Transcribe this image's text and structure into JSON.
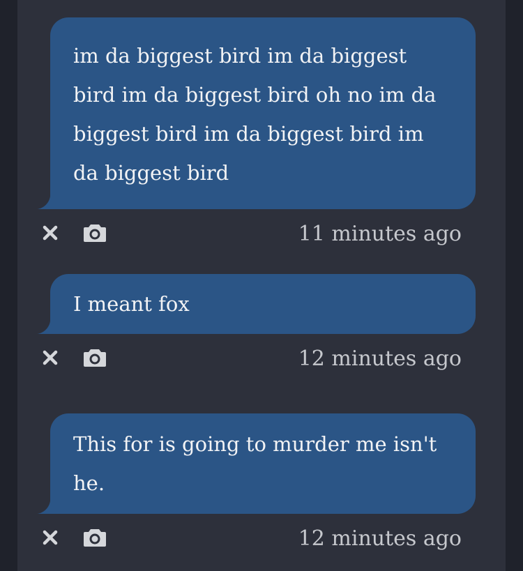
{
  "messages": [
    {
      "text": "im da biggest bird im da biggest bird im da biggest bird oh no im da biggest bird im da biggest bird im da biggest bird",
      "timestamp": "11 minutes ago",
      "actions": {
        "delete_icon": "close-icon",
        "screenshot_icon": "camera-icon"
      }
    },
    {
      "text": "I meant fox",
      "timestamp": "12 minutes ago",
      "actions": {
        "delete_icon": "close-icon",
        "screenshot_icon": "camera-icon"
      }
    },
    {
      "text": "This for is going to murder me isn't he.",
      "timestamp": "12 minutes ago",
      "actions": {
        "delete_icon": "close-icon",
        "screenshot_icon": "camera-icon"
      }
    }
  ],
  "colors": {
    "page_background": "#1f222b",
    "panel_background": "#2d303b",
    "bubble": "#2b5586",
    "bubble_text": "#f2f3f5",
    "meta_text": "#c6c8cd",
    "icon": "#d5d7db"
  }
}
